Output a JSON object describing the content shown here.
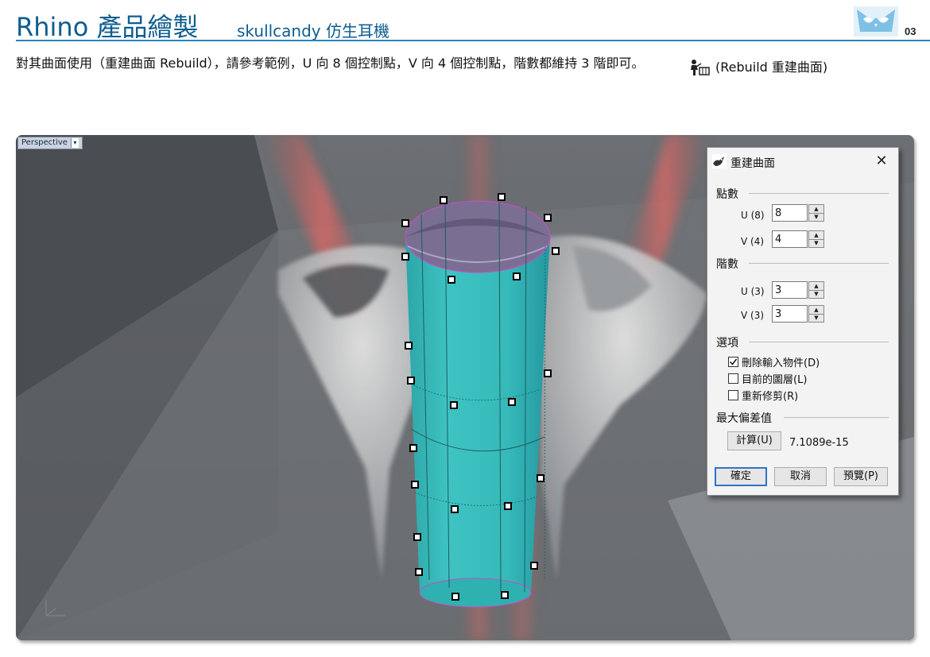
{
  "header": {
    "title": "Rhino 產品繪製",
    "subtitle": "skullcandy 仿生耳機",
    "page_number": "03",
    "accent_color": "#0f5d8e"
  },
  "instruction": {
    "text": "對其曲面使用（重建曲面 Rebuild），請參考範例，U 向 8 個控制點，V 向 4 個控制點，階數都維持 3 階即可。",
    "hint": "(Rebuild 重建曲面)"
  },
  "viewport": {
    "tab_label": "Perspective",
    "model_color": "#37bcbb"
  },
  "dialog": {
    "title": "重建曲面",
    "points_section": "點數",
    "u_points_label": "U (8)",
    "u_points_value": "8",
    "v_points_label": "V (4)",
    "v_points_value": "4",
    "degree_section": "階數",
    "u_degree_label": "U (3)",
    "u_degree_value": "3",
    "v_degree_label": "V (3)",
    "v_degree_value": "3",
    "options_section": "選項",
    "option_delete_input": "刪除輸入物件(D)",
    "option_delete_input_checked": true,
    "option_current_layer": "目前的圖層(L)",
    "option_current_layer_checked": false,
    "option_retrim": "重新修剪(R)",
    "option_retrim_checked": false,
    "deviation_section": "最大偏差值",
    "calculate_label": "計算(U)",
    "deviation_value": "7.1089e-15",
    "ok_label": "確定",
    "cancel_label": "取消",
    "preview_label": "預覽(P)"
  }
}
